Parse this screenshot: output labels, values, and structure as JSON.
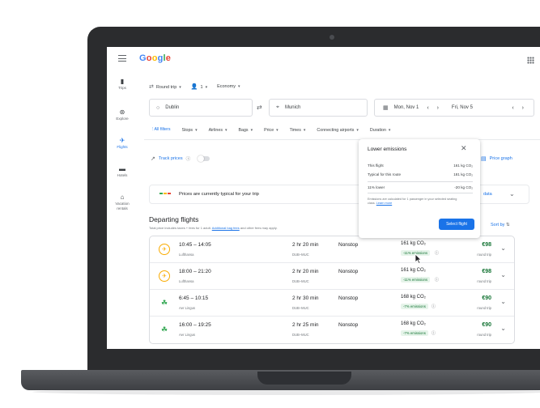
{
  "app": {
    "logo": [
      "G",
      "o",
      "o",
      "g",
      "l",
      "e"
    ]
  },
  "nav": [
    {
      "label": "Trips",
      "icon": "suitcase-icon",
      "glyph": "▮"
    },
    {
      "label": "Explore",
      "icon": "explore-icon",
      "glyph": "⊛"
    },
    {
      "label": "Flights",
      "icon": "airplane-icon",
      "glyph": "✈"
    },
    {
      "label": "Hotels",
      "icon": "bed-icon",
      "glyph": "▬"
    },
    {
      "label": "Vacation rentals",
      "icon": "house-icon",
      "glyph": "⌂"
    }
  ],
  "search": {
    "trip_type": "Round trip",
    "passengers": "1",
    "cabin": "Economy",
    "origin": "Dublin",
    "destination": "Munich",
    "depart_date": "Mon, Nov 1",
    "return_date": "Fri, Nov 5"
  },
  "filters": [
    "All filters",
    "Stops",
    "Airlines",
    "Bags",
    "Price",
    "Times",
    "Connecting airports",
    "Duration"
  ],
  "track": {
    "label": "Track prices",
    "price_graph": "Price graph"
  },
  "banner": {
    "text": "Prices are currently typical for your trip",
    "link": "data"
  },
  "departing": {
    "title": "Departing flights",
    "subtitle": "Total price includes taxes + fees for 1 adult.",
    "subtitle_link": "Additional bag fees",
    "subtitle_tail": "and other fees may apply.",
    "sort": "Sort by"
  },
  "flights": [
    {
      "times": "10:45 – 14:05",
      "airline": "Lufthansa",
      "logo": "lufthansa",
      "duration": "2 hr 20 min",
      "route": "DUB–MUC",
      "stops": "Nonstop",
      "co2": "161 kg CO₂",
      "emissions": "-11% emissions",
      "price": "€98",
      "price_type": "round trip"
    },
    {
      "times": "18:00 – 21:20",
      "airline": "Lufthansa",
      "logo": "lufthansa",
      "duration": "2 hr 20 min",
      "route": "DUB–MUC",
      "stops": "Nonstop",
      "co2": "161 kg CO₂",
      "emissions": "-11% emissions",
      "price": "€98",
      "price_type": "round trip"
    },
    {
      "times": "6:45 – 10:15",
      "airline": "Aer Lingus",
      "logo": "aer-lingus",
      "duration": "2 hr 30 min",
      "route": "DUB–MUC",
      "stops": "Nonstop",
      "co2": "168 kg CO₂",
      "emissions": "-7% emissions",
      "price": "€90",
      "price_type": "round trip"
    },
    {
      "times": "16:00 – 19:25",
      "airline": "Aer Lingus",
      "logo": "aer-lingus",
      "duration": "2 hr 25 min",
      "route": "DUB–MUC",
      "stops": "Nonstop",
      "co2": "168 kg CO₂",
      "emissions": "-7% emissions",
      "price": "€90",
      "price_type": "round trip"
    }
  ],
  "popup": {
    "title": "Lower emissions",
    "rows": [
      {
        "label": "This flight",
        "value": "161 kg CO₂"
      },
      {
        "label": "Typical for this route",
        "value": "181 kg CO₂"
      },
      {
        "label": "11% lower",
        "value": "-20 kg CO₂"
      }
    ],
    "note": "Emissions are calculated for 1 passenger in your selected seating class.",
    "note_link": "Learn more",
    "button": "Select flight"
  },
  "colors": {
    "accent": "#1a73e8",
    "price_green": "#137333",
    "badge_bg": "#e6f4ea"
  }
}
